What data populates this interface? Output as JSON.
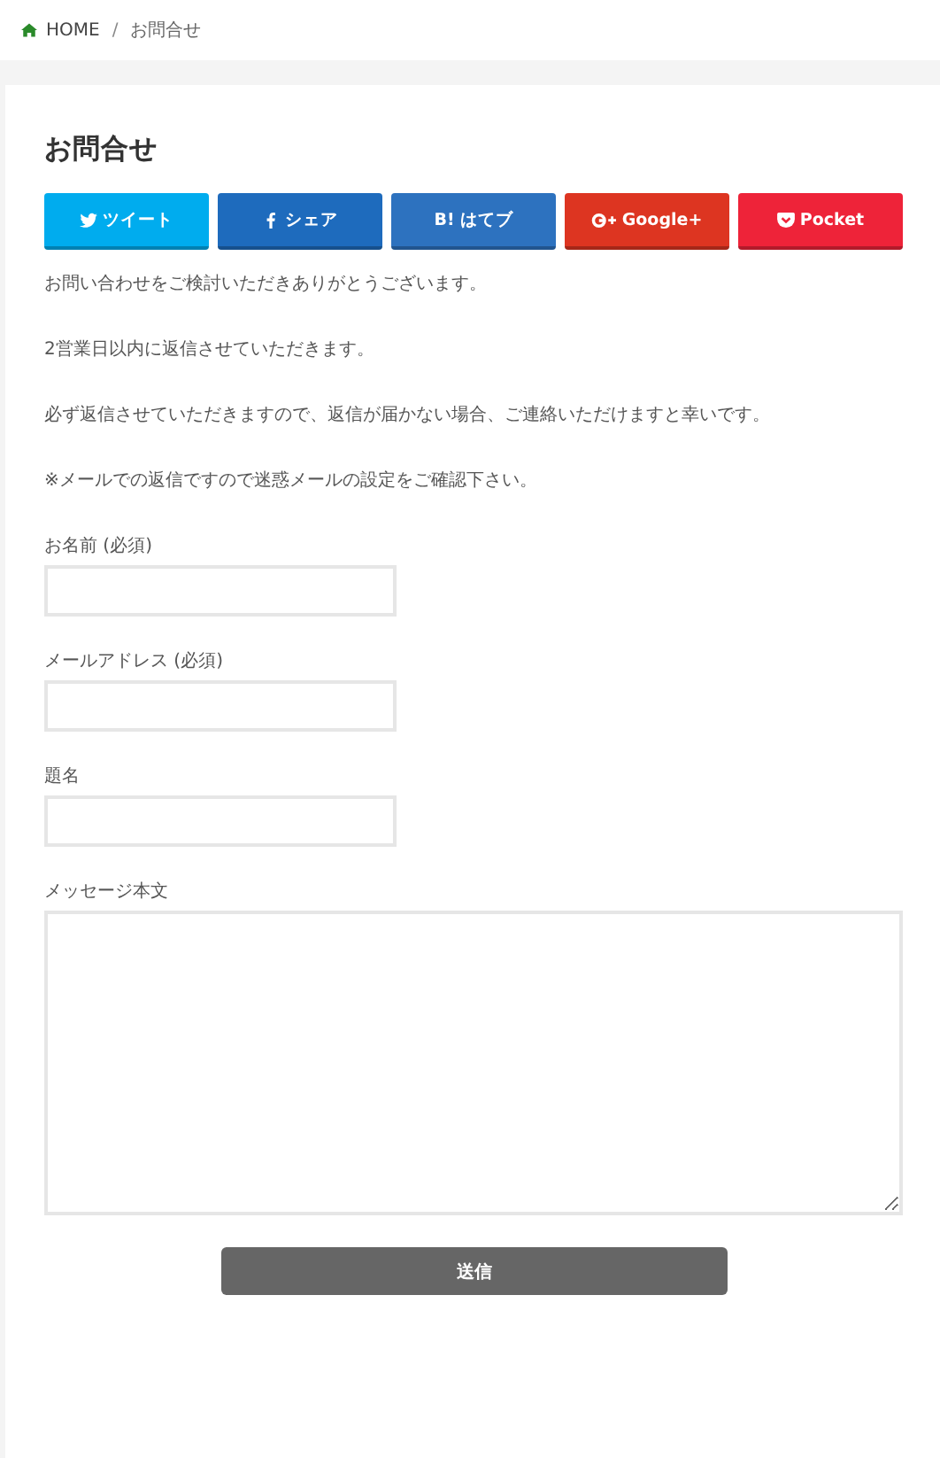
{
  "breadcrumb_separator": "/",
  "breadcrumb": [
    {
      "label": "HOME",
      "kind": "home"
    },
    {
      "label": "お問合せ",
      "kind": "current"
    }
  ],
  "title": "お問合せ",
  "share_buttons": [
    {
      "label": "ツイート",
      "kind": "twitter",
      "color": "#00acee"
    },
    {
      "label": "シェア",
      "kind": "facebook",
      "color": "#1e6bbd"
    },
    {
      "label": "はてブ",
      "kind": "hatena",
      "icon": "B!",
      "color": "#2d72bf"
    },
    {
      "label": "Google+",
      "kind": "google",
      "color": "#dd3521"
    },
    {
      "label": "Pocket",
      "kind": "pocket",
      "color": "#ee2339"
    }
  ],
  "paragraphs": [
    "お問い合わせをご検討いただきありがとうございます。",
    "2営業日以内に返信させていただきます。",
    "必ず返信させていただきますので、返信が届かない場合、ご連絡いただけますと幸いです。",
    "※メールでの返信ですので迷惑メールの設定をご確認下さい。"
  ],
  "fields": [
    {
      "label": "お名前 (必須)",
      "kind": "text"
    },
    {
      "label": "メールアドレス (必須)",
      "kind": "text"
    },
    {
      "label": "題名",
      "kind": "text"
    },
    {
      "label": "メッセージ本文",
      "kind": "textarea"
    }
  ],
  "submit": "送信"
}
